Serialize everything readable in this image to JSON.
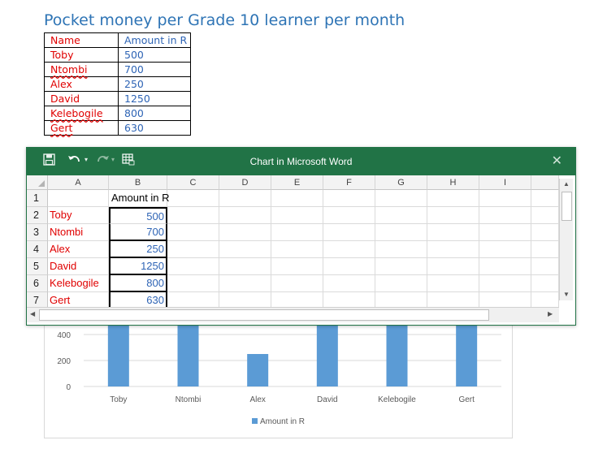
{
  "document": {
    "title": "Pocket money per Grade 10 learner per month",
    "table": {
      "headers": [
        "Name",
        "Amount in R"
      ],
      "rows": [
        {
          "name": "Toby",
          "amount": "500"
        },
        {
          "name": "Ntombi",
          "amount": "700"
        },
        {
          "name": "Alex",
          "amount": "250"
        },
        {
          "name": "David",
          "amount": "1250"
        },
        {
          "name": "Kelebogile",
          "amount": "800"
        },
        {
          "name": "Gert",
          "amount": "630"
        }
      ]
    }
  },
  "excel_window": {
    "title": "Chart in Microsoft Word",
    "columns": [
      "A",
      "B",
      "C",
      "D",
      "E",
      "F",
      "G",
      "H",
      "I"
    ],
    "row_numbers": [
      "1",
      "2",
      "3",
      "4",
      "5",
      "6",
      "7"
    ],
    "header_cell": "Amount in R",
    "rows": [
      {
        "name": "Toby",
        "amount": "500"
      },
      {
        "name": "Ntombi",
        "amount": "700"
      },
      {
        "name": "Alex",
        "amount": "250"
      },
      {
        "name": "David",
        "amount": "1250"
      },
      {
        "name": "Kelebogile",
        "amount": "800"
      },
      {
        "name": "Gert",
        "amount": "630"
      }
    ],
    "icons": [
      "save-icon",
      "undo-icon",
      "redo-icon",
      "edit-data-icon",
      "close-icon"
    ]
  },
  "colors": {
    "bar": "#5b9bd5",
    "excel_green": "#217346",
    "title_blue": "#2e74b5",
    "name_red": "#e00000"
  },
  "chart_data": {
    "type": "bar",
    "categories": [
      "Toby",
      "Ntombi",
      "Alex",
      "David",
      "Kelebogile",
      "Gert"
    ],
    "series": [
      {
        "name": "Amount in R",
        "values": [
          500,
          700,
          250,
          1250,
          800,
          630
        ]
      }
    ],
    "y_ticks": [
      "0",
      "200",
      "400"
    ],
    "ylim": [
      0,
      1400
    ],
    "legend": "bottom"
  }
}
